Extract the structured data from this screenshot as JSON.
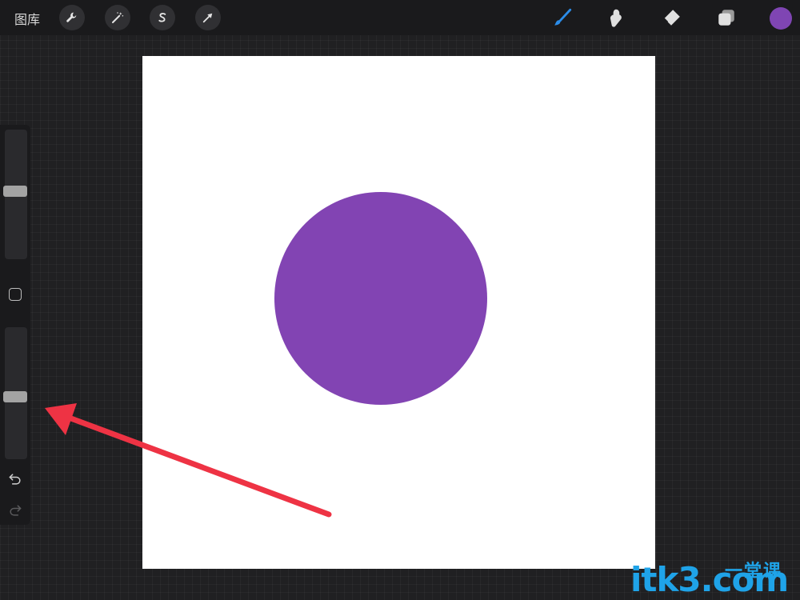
{
  "topbar": {
    "gallery_label": "图库",
    "actions_icon": "wrench-icon",
    "adjustments_icon": "magic-wand-icon",
    "selection_icon": "selection-s-icon",
    "transform_icon": "transform-arrow-icon",
    "brush_icon": "brush-icon",
    "smudge_icon": "smudge-icon",
    "eraser_icon": "eraser-icon",
    "layers_icon": "layers-icon",
    "current_color": "#7f45b3"
  },
  "canvas": {
    "background": "#ffffff",
    "shape_color": "#8244b3"
  },
  "sidebar": {
    "brush_size_level": 0.47,
    "opacity_level": 0.53,
    "undo_icon": "undo-icon",
    "redo_icon": "redo-icon"
  },
  "annotation": {
    "color": "#ee3344"
  },
  "watermark": {
    "domain": "itk3.com",
    "tag": "一堂课"
  }
}
